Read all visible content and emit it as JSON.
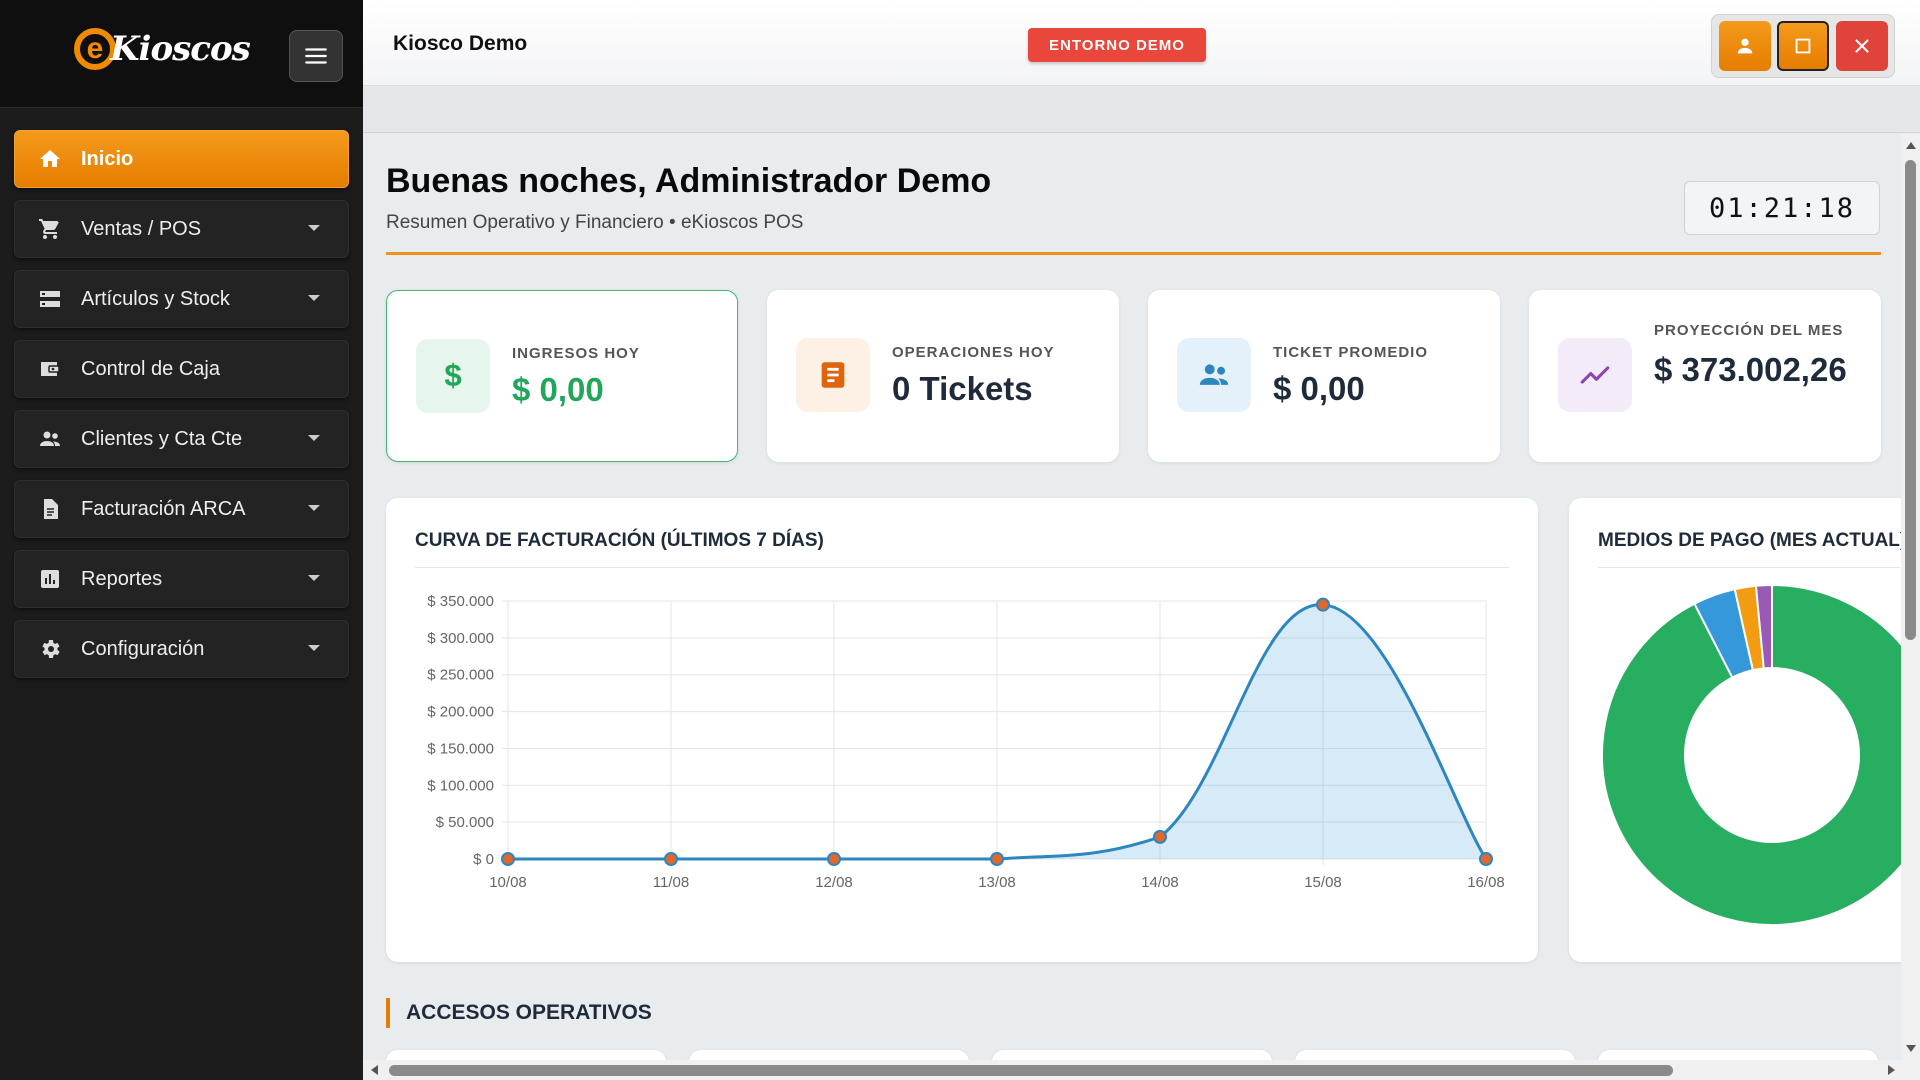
{
  "app": {
    "logo_letter": "e",
    "logo_text": "Kioscos"
  },
  "sidebar": {
    "items": [
      {
        "label": "Inicio",
        "icon": "home-icon",
        "active": true
      },
      {
        "label": "Ventas / POS",
        "icon": "cart-icon"
      },
      {
        "label": "Artículos y Stock",
        "icon": "storage-icon"
      },
      {
        "label": "Control de Caja",
        "icon": "cashbox-icon"
      },
      {
        "label": "Clientes y Cta Cte",
        "icon": "people-icon"
      },
      {
        "label": "Facturación ARCA",
        "icon": "document-icon"
      },
      {
        "label": "Reportes",
        "icon": "bar-chart-icon"
      },
      {
        "label": "Configuración",
        "icon": "gear-icon"
      }
    ]
  },
  "topbar": {
    "store_name": "Kiosco Demo",
    "demo_badge": "ENTORNO DEMO"
  },
  "header": {
    "greeting": "Buenas noches, Administrador Demo",
    "subtitle": "Resumen Operativo y Financiero • eKioscos POS",
    "clock": "01:21:18"
  },
  "kpis": [
    {
      "label": "Ingresos Hoy",
      "value": "$ 0,00",
      "icon": "dollar-icon"
    },
    {
      "label": "Operaciones Hoy",
      "value": "0 Tickets",
      "icon": "receipt-icon"
    },
    {
      "label": "Ticket Promedio",
      "value": "$ 0,00",
      "icon": "people-icon"
    },
    {
      "label": "Proyección del Mes",
      "value": "$ 373.002,26",
      "icon": "trend-icon"
    }
  ],
  "colors": {
    "accent": "#f08a00",
    "green": "#22a65a",
    "line": "#2e86c1",
    "point": "#e2672a",
    "sidebar": "#1c1c1c"
  },
  "chart_data": [
    {
      "type": "area",
      "title": "CURVA DE FACTURACIÓN (ÚLTIMOS 7 DÍAS)",
      "categories": [
        "10/08",
        "11/08",
        "12/08",
        "13/08",
        "14/08",
        "15/08",
        "16/08"
      ],
      "values": [
        0,
        0,
        0,
        0,
        30000,
        345000,
        0
      ],
      "ylim": [
        0,
        350000
      ],
      "yticks": [
        0,
        50000,
        100000,
        150000,
        200000,
        250000,
        300000,
        350000
      ],
      "ytick_labels": [
        "$ 0",
        "$ 50.000",
        "$ 100.000",
        "$ 150.000",
        "$ 200.000",
        "$ 250.000",
        "$ 300.000",
        "$ 350.000"
      ],
      "grid": true
    },
    {
      "type": "pie",
      "title": "MEDIOS DE PAGO (MES ACTUAL)",
      "values": [
        92,
        4,
        2,
        1.5
      ],
      "colors": [
        "#27ae60",
        "#3498db",
        "#f39c12",
        "#9b59b6"
      ]
    }
  ],
  "section": {
    "accesos_title": "ACCESOS OPERATIVOS"
  }
}
